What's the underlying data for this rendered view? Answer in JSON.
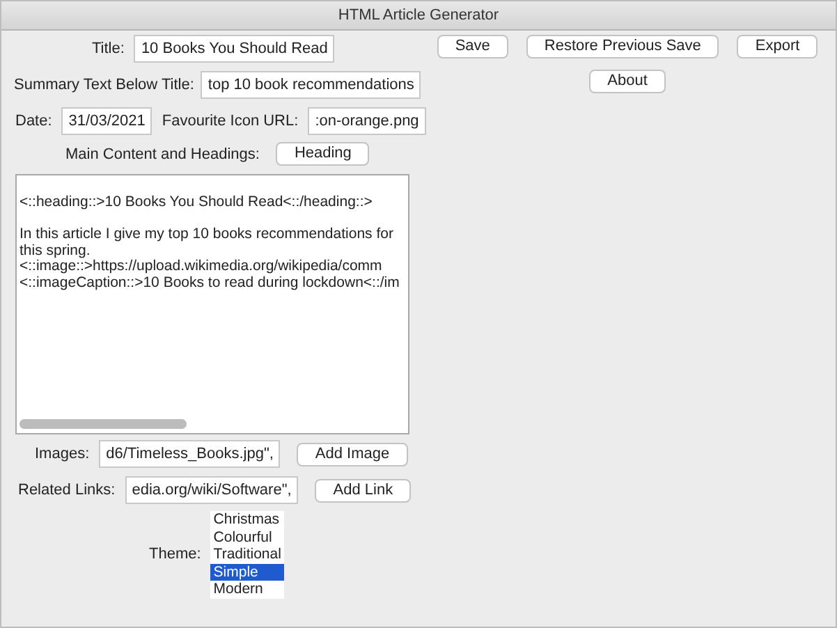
{
  "window": {
    "title": "HTML Article Generator"
  },
  "form": {
    "title": {
      "label": "Title:",
      "value": "10 Books You Should Read"
    },
    "summary": {
      "label": "Summary Text Below Title:",
      "value": "top 10 book recommendations"
    },
    "date": {
      "label": "Date:",
      "value": "31/03/2021"
    },
    "favicon": {
      "label": "Favourite Icon URL:",
      "value": ":on-orange.png"
    },
    "content": {
      "label": "Main Content and Headings:",
      "button": "Heading",
      "lines": [
        {
          "text": "<::heading::>10 Books You Should Read<::/heading::>",
          "space_before": false
        },
        {
          "text": "In this article I give my top 10 books recommendations for",
          "space_before": true
        },
        {
          "text": "this spring.",
          "space_before": false
        },
        {
          "text": "<::image::>https://upload.wikimedia.org/wikipedia/comm",
          "space_before": false
        },
        {
          "text": "<::imageCaption::>10 Books to read during lockdown<::/im",
          "space_before": false
        }
      ]
    },
    "images": {
      "label": "Images:",
      "value": "d6/Timeless_Books.jpg\",",
      "button": "Add Image"
    },
    "links": {
      "label": "Related Links:",
      "value": "edia.org/wiki/Software\",",
      "button": "Add Link"
    },
    "theme": {
      "label": "Theme:",
      "options": [
        {
          "label": "Christmas",
          "selected": false
        },
        {
          "label": "Colourful",
          "selected": false
        },
        {
          "label": "Traditional",
          "selected": false
        },
        {
          "label": "Simple",
          "selected": true
        },
        {
          "label": "Modern",
          "selected": false
        }
      ]
    }
  },
  "actions": {
    "buttons": [
      "Save",
      "Restore Previous Save",
      "Export"
    ],
    "about": "About"
  }
}
